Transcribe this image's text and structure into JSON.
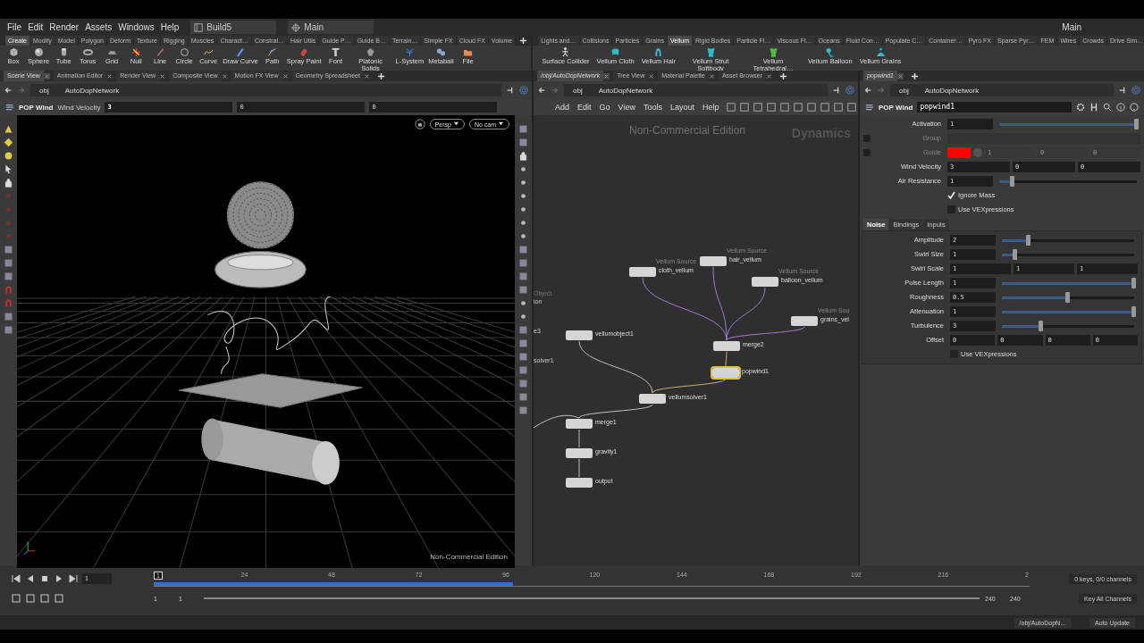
{
  "menubar": {
    "menus": [
      "File",
      "Edit",
      "Render",
      "Assets",
      "Windows",
      "Help"
    ],
    "desktop": "Build5",
    "viewport_set": "Main",
    "right_desktop": "Main"
  },
  "shelf_left": {
    "tabs": [
      {
        "label": "Create",
        "selected": true
      },
      {
        "label": "Modify",
        "selected": false
      },
      {
        "label": "Model",
        "selected": false
      },
      {
        "label": "Polygon",
        "selected": false
      },
      {
        "label": "Deform",
        "selected": false
      },
      {
        "label": "Texture",
        "selected": false
      },
      {
        "label": "Rigging",
        "selected": false
      },
      {
        "label": "Muscles",
        "selected": false
      },
      {
        "label": "Charact…",
        "selected": false
      },
      {
        "label": "Constrai…",
        "selected": false
      },
      {
        "label": "Hair Utils",
        "selected": false
      },
      {
        "label": "Guide P…",
        "selected": false
      },
      {
        "label": "Guide B…",
        "selected": false
      },
      {
        "label": "Terrain…",
        "selected": false
      },
      {
        "label": "Simple FX",
        "selected": false
      },
      {
        "label": "Cloud FX",
        "selected": false
      },
      {
        "label": "Volume",
        "selected": false
      }
    ],
    "tools": [
      "Box",
      "Sphere",
      "Tube",
      "Torus",
      "Grid",
      "Null",
      "Line",
      "Circle",
      "Curve",
      "Draw Curve",
      "Path",
      "Spray Paint",
      "Font",
      "Platonic Solids",
      "L-System",
      "Metaball",
      "File"
    ]
  },
  "shelf_right": {
    "tabs": [
      {
        "label": "Lights and…",
        "selected": false
      },
      {
        "label": "Collisions",
        "selected": false
      },
      {
        "label": "Particles",
        "selected": false
      },
      {
        "label": "Grains",
        "selected": false
      },
      {
        "label": "Vellum",
        "selected": true
      },
      {
        "label": "Rigid Bodies",
        "selected": false
      },
      {
        "label": "Particle Fl…",
        "selected": false
      },
      {
        "label": "Viscous Fl…",
        "selected": false
      },
      {
        "label": "Oceans",
        "selected": false
      },
      {
        "label": "Fluid Con…",
        "selected": false
      },
      {
        "label": "Populate C…",
        "selected": false
      },
      {
        "label": "Container…",
        "selected": false
      },
      {
        "label": "Pyro FX",
        "selected": false
      },
      {
        "label": "Sparse Pyr…",
        "selected": false
      },
      {
        "label": "FEM",
        "selected": false
      },
      {
        "label": "Wires",
        "selected": false
      },
      {
        "label": "Crowds",
        "selected": false
      },
      {
        "label": "Drive Sim…",
        "selected": false
      }
    ],
    "tools": [
      "Surface Collider",
      "Vellum Cloth",
      "Vellum Hair",
      "Vellum Strut Softbody",
      "Vellum Tetrahedral…",
      "Vellum Balloon",
      "Vellum Grains"
    ]
  },
  "scene_pane": {
    "tabs": [
      {
        "label": "Scene View",
        "selected": true
      },
      {
        "label": "Animation Editor",
        "selected": false
      },
      {
        "label": "Render View",
        "selected": false
      },
      {
        "label": "Composite View",
        "selected": false
      },
      {
        "label": "Motion FX View",
        "selected": false
      },
      {
        "label": "Geometry Spreadsheet",
        "selected": false
      }
    ],
    "path": [
      "obj",
      "AutoDopNetwork"
    ],
    "op_toolbar": {
      "node_type": "POP Wind",
      "param_label": "Wind Velocity",
      "values": [
        "3",
        "0",
        "0"
      ]
    },
    "viewport": {
      "camera_menus": [
        "Persp",
        "No cam"
      ],
      "edition": "Non-Commercial Edition"
    }
  },
  "network_pane": {
    "tabs": [
      {
        "label": "/obj/AutoDopNetwork",
        "selected": true
      },
      {
        "label": "Tree View",
        "selected": false
      },
      {
        "label": "Material Palette",
        "selected": false
      },
      {
        "label": "Asset Browser",
        "selected": false
      }
    ],
    "path": [
      "obj",
      "AutoDopNetwork"
    ],
    "menus": [
      "Add",
      "Edit",
      "Go",
      "View",
      "Tools",
      "Layout",
      "Help"
    ],
    "edition": "Non-Commercial Edition",
    "context": "Dynamics",
    "clipped_labels": [
      {
        "text": "Object",
        "kind": "subtitle"
      },
      {
        "text": "ion",
        "kind": "name"
      },
      {
        "text": "e3",
        "kind": "name"
      },
      {
        "text": "solver1",
        "kind": "name"
      }
    ],
    "nodes": [
      {
        "name": "cloth_vellum",
        "subtitle": "Vellum Source",
        "selected": false
      },
      {
        "name": "hair_vellum",
        "subtitle": "Vellum Source",
        "selected": false
      },
      {
        "name": "balloon_vellum",
        "subtitle": "Vellum Source",
        "selected": false
      },
      {
        "name": "grains_vel",
        "subtitle": "Vellum Sou",
        "selected": false
      },
      {
        "name": "vellumobject1",
        "selected": false
      },
      {
        "name": "merge2",
        "selected": false
      },
      {
        "name": "popwind1",
        "selected": true
      },
      {
        "name": "vellumsolver1",
        "selected": false
      },
      {
        "name": "merge1",
        "selected": false
      },
      {
        "name": "gravity1",
        "selected": false
      },
      {
        "name": "output",
        "selected": false
      }
    ]
  },
  "param_pane": {
    "tab": "popwind1",
    "path": [
      "obj",
      "AutoDopNetwork"
    ],
    "node_type": "POP Wind",
    "node_name": "popwind1",
    "items": [
      {
        "kind": "slider",
        "label": "Activation",
        "values": [
          "1"
        ],
        "level": 1
      },
      {
        "kind": "menu",
        "label": "Group",
        "disabled": true,
        "checked": false
      },
      {
        "kind": "color",
        "label": "Guide",
        "disabled": true,
        "checked": false,
        "color": "#ff0000",
        "values": [
          "1",
          "0",
          "0"
        ]
      },
      {
        "kind": "vector",
        "label": "Wind Velocity",
        "values": [
          "3",
          "0",
          "0"
        ]
      },
      {
        "kind": "slider",
        "label": "Air Resistance",
        "values": [
          "1"
        ],
        "level": 0.1
      },
      {
        "kind": "toggle",
        "label": "Ignore Mass",
        "checked": true
      },
      {
        "kind": "toggle",
        "label": "Use VEXpressions",
        "checked": false
      }
    ],
    "subtabs": [
      {
        "label": "Noise",
        "selected": true
      },
      {
        "label": "Bindings",
        "selected": false
      },
      {
        "label": "Inputs",
        "selected": false
      }
    ],
    "noise": [
      {
        "kind": "slider",
        "label": "Amplitude",
        "values": [
          "2"
        ],
        "level": 0.2
      },
      {
        "kind": "slider",
        "label": "Swirl Size",
        "values": [
          "1"
        ],
        "level": 0.1
      },
      {
        "kind": "vector",
        "label": "Swirl Scale",
        "values": [
          "1",
          "1",
          "1"
        ]
      },
      {
        "kind": "slider",
        "label": "Pulse Length",
        "values": [
          "1"
        ],
        "level": 1
      },
      {
        "kind": "slider",
        "label": "Roughness",
        "values": [
          "0.5"
        ],
        "level": 0.5
      },
      {
        "kind": "slider",
        "label": "Attenuation",
        "values": [
          "1"
        ],
        "level": 1
      },
      {
        "kind": "slider",
        "label": "Turbulence",
        "values": [
          "3"
        ],
        "level": 0.3
      },
      {
        "kind": "vector",
        "label": "Offset",
        "values": [
          "0",
          "0",
          "0",
          "0"
        ]
      },
      {
        "kind": "toggle",
        "label": "Use VEXpressions",
        "checked": false
      }
    ]
  },
  "timeline": {
    "frame": "1",
    "current": "1",
    "ticks": [
      "24",
      "48",
      "72",
      "96",
      "120",
      "144",
      "168",
      "192",
      "216",
      "2"
    ],
    "level": 0.41,
    "range": [
      "1",
      "1",
      "240",
      "240"
    ],
    "range_slider": {
      "level": 1
    },
    "keys": "0 keys, 0/0 channels",
    "key_all": "Key All Channels"
  },
  "status_bar": {
    "path": "/obj/AutoDopN…",
    "update_mode": "Auto Update"
  }
}
